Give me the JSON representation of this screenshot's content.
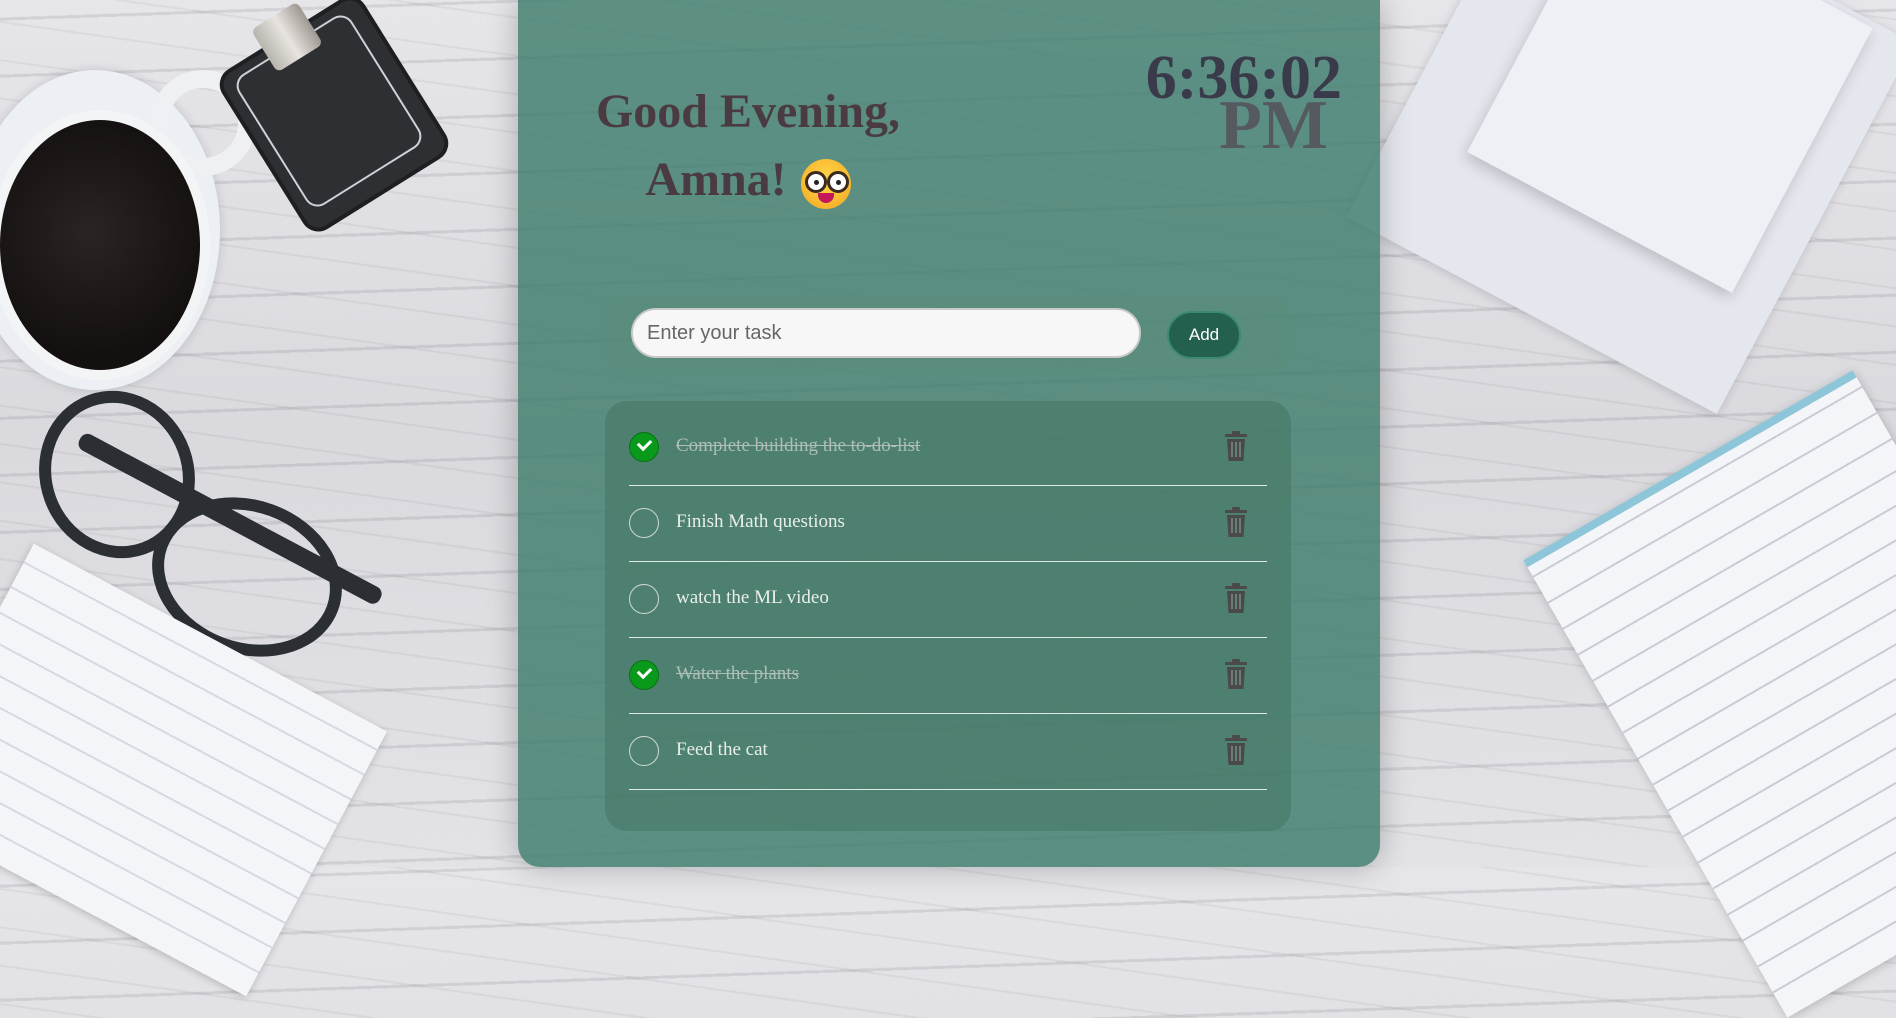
{
  "greeting": {
    "line1": "Good Evening,",
    "line2": "Amna!",
    "emoji": "nerd-face-icon"
  },
  "clock": {
    "time": "6:36:02",
    "ampm": "PM"
  },
  "task_input": {
    "placeholder": "Enter your task",
    "value": ""
  },
  "add_button": {
    "label": "Add"
  },
  "tasks": [
    {
      "text": "Complete building the to-do-list",
      "done": true
    },
    {
      "text": "Finish Math questions",
      "done": false
    },
    {
      "text": "watch the ML video",
      "done": false
    },
    {
      "text": "Water the plants",
      "done": true
    },
    {
      "text": "Feed the cat",
      "done": false
    }
  ],
  "colors": {
    "panel": "#3e7d6c",
    "checked": "#0a9a1b",
    "add_button": "#23604e",
    "greeting_text": "#4a3b42"
  },
  "icons": {
    "trash": "trash-icon",
    "check": "check-icon"
  }
}
